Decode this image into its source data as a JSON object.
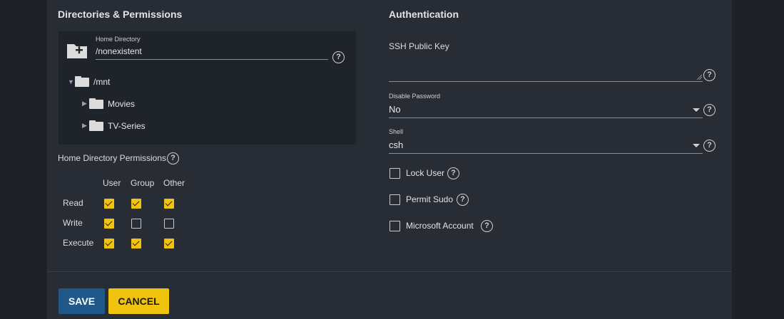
{
  "directories": {
    "title": "Directories & Permissions",
    "home_directory": {
      "label": "Home Directory",
      "value": "/nonexistent"
    },
    "tree": {
      "root": "/mnt",
      "children": [
        "Movies",
        "TV-Series"
      ]
    },
    "permissions": {
      "label": "Home Directory Permissions",
      "columns": [
        "User",
        "Group",
        "Other"
      ],
      "rows": [
        {
          "label": "Read",
          "values": [
            true,
            true,
            true
          ]
        },
        {
          "label": "Write",
          "values": [
            true,
            false,
            false
          ]
        },
        {
          "label": "Execute",
          "values": [
            true,
            true,
            true
          ]
        }
      ]
    }
  },
  "authentication": {
    "title": "Authentication",
    "ssh_key": {
      "label": "SSH Public Key",
      "value": ""
    },
    "disable_password": {
      "label": "Disable Password",
      "value": "No"
    },
    "shell": {
      "label": "Shell",
      "value": "csh"
    },
    "options": [
      {
        "label": "Lock User",
        "checked": false
      },
      {
        "label": "Permit Sudo",
        "checked": false
      },
      {
        "label": "Microsoft Account",
        "checked": false
      }
    ]
  },
  "actions": {
    "save": "SAVE",
    "cancel": "CANCEL"
  },
  "colors": {
    "accent": "#f0c30f",
    "primary": "#1f5889",
    "background": "#282d35"
  }
}
